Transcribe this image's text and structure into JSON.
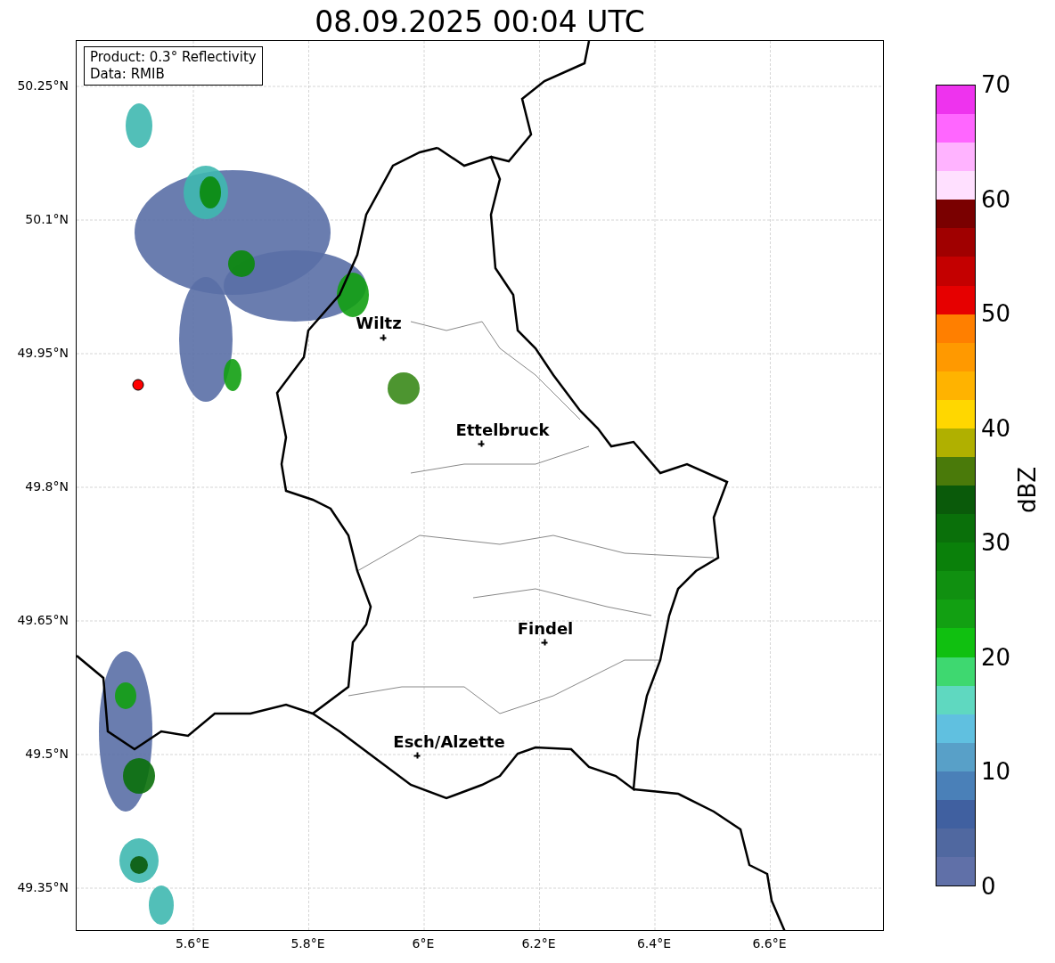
{
  "title": "08.09.2025 00:04 UTC",
  "info_box": [
    "Product: 0.3° Reflectivity",
    "Data: RMIB"
  ],
  "cities": [
    {
      "name": "Wiltz"
    },
    {
      "name": "Ettelbruck"
    },
    {
      "name": "Findel"
    },
    {
      "name": "Esch/Alzette"
    }
  ],
  "lat_ticks": [
    "50.25°N",
    "50.1°N",
    "49.95°N",
    "49.8°N",
    "49.65°N",
    "49.5°N",
    "49.35°N"
  ],
  "lon_ticks": [
    "5.6°E",
    "5.8°E",
    "6°E",
    "6.2°E",
    "6.4°E",
    "6.6°E"
  ],
  "colorbar": {
    "label": "dBZ",
    "ticks": [
      "70",
      "60",
      "50",
      "40",
      "30",
      "20",
      "10",
      "0"
    ],
    "segments": [
      {
        "color": "#ee33ee"
      },
      {
        "color": "#ff66ff"
      },
      {
        "color": "#ffb3ff"
      },
      {
        "color": "#ffe0ff"
      },
      {
        "color": "#7a0000"
      },
      {
        "color": "#a00000"
      },
      {
        "color": "#c40000"
      },
      {
        "color": "#e60000"
      },
      {
        "color": "#ff7f00"
      },
      {
        "color": "#ff9900"
      },
      {
        "color": "#ffb300"
      },
      {
        "color": "#ffd700"
      },
      {
        "color": "#b0b000"
      },
      {
        "color": "#4a7a0a"
      },
      {
        "color": "#0a5a0a"
      },
      {
        "color": "#0a700a"
      },
      {
        "color": "#0a800a"
      },
      {
        "color": "#109010"
      },
      {
        "color": "#12a012"
      },
      {
        "color": "#10c010"
      },
      {
        "color": "#3ed870"
      },
      {
        "color": "#5fd8c0"
      },
      {
        "color": "#60c0e0"
      },
      {
        "color": "#58a0c8"
      },
      {
        "color": "#4a80b8"
      },
      {
        "color": "#4060a0"
      },
      {
        "color": "#5068a0"
      },
      {
        "color": "#6070a8"
      }
    ]
  }
}
